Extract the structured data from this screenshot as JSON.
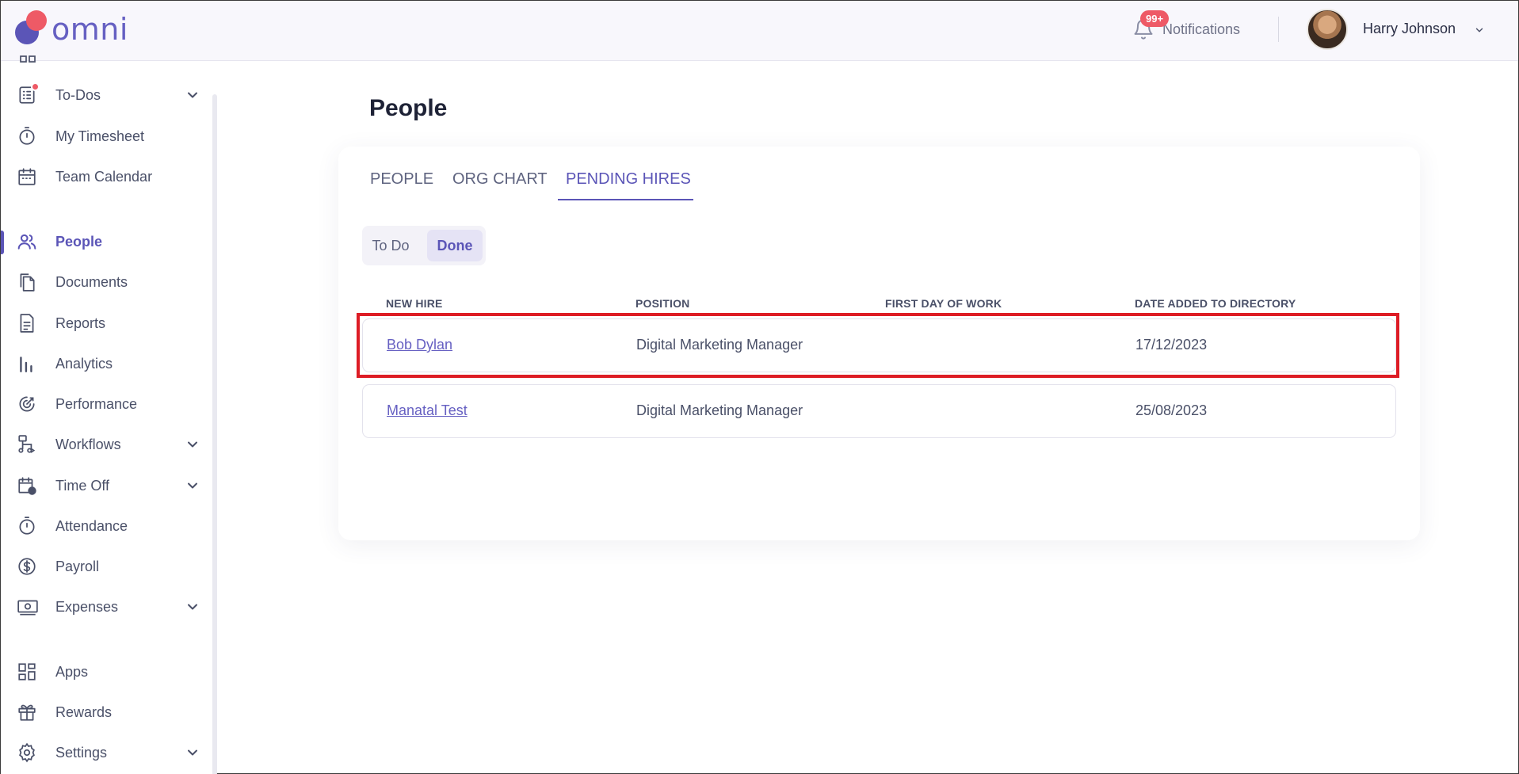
{
  "header": {
    "logo_text": "omni",
    "notifications": {
      "badge": "99+",
      "label": "Notifications"
    },
    "user": {
      "name": "Harry Johnson"
    }
  },
  "sidebar": {
    "items": [
      {
        "label": "To-Dos",
        "icon": "checklist-icon",
        "has_chevron": true
      },
      {
        "label": "My Timesheet",
        "icon": "stopwatch-icon"
      },
      {
        "label": "Team Calendar",
        "icon": "calendar-icon"
      },
      {
        "label": "People",
        "icon": "people-icon",
        "active": true
      },
      {
        "label": "Documents",
        "icon": "documents-icon"
      },
      {
        "label": "Reports",
        "icon": "report-icon"
      },
      {
        "label": "Analytics",
        "icon": "bar-chart-icon"
      },
      {
        "label": "Performance",
        "icon": "target-icon"
      },
      {
        "label": "Workflows",
        "icon": "workflow-icon",
        "has_chevron": true
      },
      {
        "label": "Time Off",
        "icon": "calendar-clock-icon",
        "has_chevron": true
      },
      {
        "label": "Attendance",
        "icon": "stopwatch-icon"
      },
      {
        "label": "Payroll",
        "icon": "dollar-circle-icon"
      },
      {
        "label": "Expenses",
        "icon": "cash-icon",
        "has_chevron": true
      },
      {
        "label": "Apps",
        "icon": "apps-grid-icon"
      },
      {
        "label": "Rewards",
        "icon": "gift-icon"
      },
      {
        "label": "Settings",
        "icon": "gear-icon",
        "has_chevron": true
      }
    ]
  },
  "main": {
    "title": "People",
    "tabs": [
      "PEOPLE",
      "ORG CHART",
      "PENDING HIRES"
    ],
    "active_tab": "PENDING HIRES",
    "toggle": {
      "todo": "To Do",
      "done": "Done",
      "selected": "Done"
    },
    "table": {
      "columns": [
        "NEW HIRE",
        "POSITION",
        "FIRST DAY OF WORK",
        "DATE ADDED TO DIRECTORY"
      ],
      "rows": [
        {
          "new_hire": "Bob Dylan",
          "position": "Digital Marketing Manager",
          "first_day": "",
          "date_added": "17/12/2023"
        },
        {
          "new_hire": "Manatal Test",
          "position": "Digital Marketing Manager",
          "first_day": "",
          "date_added": "25/08/2023"
        }
      ]
    }
  },
  "colors": {
    "accent": "#5b55b7",
    "badge": "#ee5a66",
    "highlight": "#dd1c25"
  }
}
